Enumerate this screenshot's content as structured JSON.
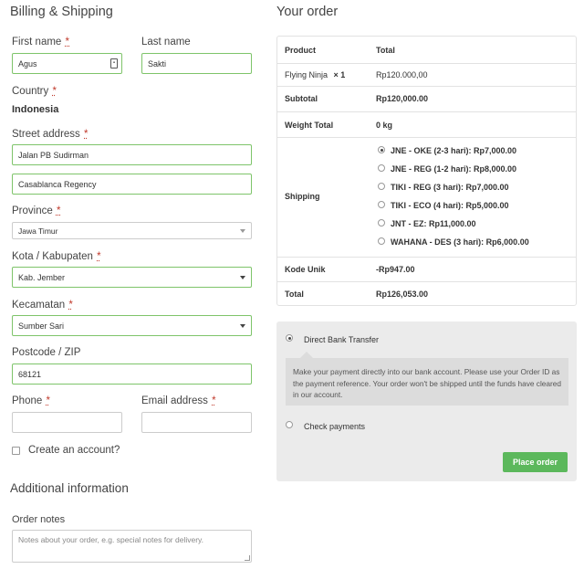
{
  "billing": {
    "title": "Billing & Shipping",
    "required_mark": "*",
    "first_name": {
      "label": "First name",
      "value": "Agus"
    },
    "last_name": {
      "label": "Last name",
      "value": "Sakti"
    },
    "country": {
      "label": "Country",
      "value": "Indonesia"
    },
    "street": {
      "label": "Street address",
      "line1": "Jalan PB Sudirman",
      "line2": "Casablanca Regency"
    },
    "province": {
      "label": "Province",
      "value": "Jawa Timur"
    },
    "kota": {
      "label": "Kota / Kabupaten",
      "value": "Kab. Jember"
    },
    "kecamatan": {
      "label": "Kecamatan",
      "value": "Sumber Sari"
    },
    "postcode": {
      "label": "Postcode / ZIP",
      "value": "68121"
    },
    "phone": {
      "label": "Phone",
      "value": ""
    },
    "email": {
      "label": "Email address",
      "value": ""
    },
    "create_account": {
      "label": "Create an account?",
      "checked": false
    }
  },
  "additional": {
    "title": "Additional information",
    "notes_label": "Order notes",
    "notes_placeholder": "Notes about your order, e.g. special notes for delivery."
  },
  "order": {
    "title": "Your order",
    "col_product": "Product",
    "col_total": "Total",
    "item_name": "Flying Ninja",
    "item_qty": "× 1",
    "item_total": "Rp120.000,00",
    "subtotal_label": "Subtotal",
    "subtotal_value": "Rp120,000.00",
    "weight_label": "Weight Total",
    "weight_value": "0 kg",
    "shipping_label": "Shipping",
    "shipping_options": [
      {
        "label": "JNE - OKE (2-3 hari): Rp7,000.00",
        "selected": true
      },
      {
        "label": "JNE - REG (1-2 hari): Rp8,000.00",
        "selected": false
      },
      {
        "label": "TIKI - REG (3 hari): Rp7,000.00",
        "selected": false
      },
      {
        "label": "TIKI - ECO (4 hari): Rp5,000.00",
        "selected": false
      },
      {
        "label": "JNT - EZ: Rp11,000.00",
        "selected": false
      },
      {
        "label": "WAHANA - DES (3 hari): Rp6,000.00",
        "selected": false
      }
    ],
    "kode_label": "Kode Unik",
    "kode_value": "-Rp947.00",
    "total_label": "Total",
    "total_value": "Rp126,053.00"
  },
  "payment": {
    "bank_label": "Direct Bank Transfer",
    "bank_selected": true,
    "bank_desc": "Make your payment directly into our bank account. Please use your Order ID as the payment reference. Your order won't be shipped until the funds have cleared in our account.",
    "check_label": "Check payments",
    "check_selected": false,
    "place_order": "Place order"
  },
  "colors": {
    "valid_border": "#7ec46a",
    "button": "#5cb85c",
    "required": "#c0392b"
  },
  "icons": {
    "autofill": "contact-card-icon",
    "dropdown": "chevron-down-icon"
  }
}
